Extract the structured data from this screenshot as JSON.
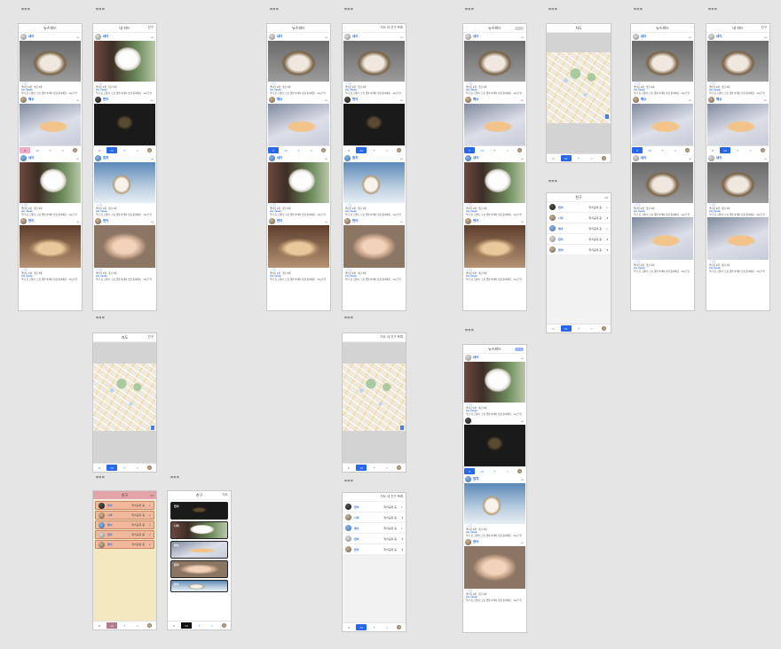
{
  "labels": {
    "a1": "===",
    "a2": "===",
    "a3": "===",
    "a4": "===",
    "a5": "===",
    "a6": "===",
    "a7": "===",
    "a8": "===",
    "b1": "===",
    "b2": "===",
    "b3": "===",
    "b4": "===",
    "c1": "===",
    "c2": "===",
    "c3": "===",
    "c4": "==="
  },
  "screen_titles": {
    "feed": "뉴스피드",
    "feed_mine": "내 피드",
    "map": "지도",
    "friends": "친구",
    "myfeed_right": "지도 내 친구 목록"
  },
  "feed": {
    "users": [
      "내이",
      "해수",
      "나비",
      "참치",
      "찐이"
    ],
    "meta": "좋아요 2개 · 댓글 3개",
    "who": "cat_meow",
    "text": "우리 집 고양이, 오늘 햇살 아래서 낮잠 중이에요 · 1시간 전"
  },
  "friends": {
    "names": [
      "찐이",
      "나비",
      "해수",
      "참치",
      "찐이"
    ],
    "status": "위치공유 중"
  },
  "tabs": {
    "home": "⌂",
    "feed": "▭",
    "add": "+",
    "search": "○"
  },
  "icons": [
    "home-icon",
    "feed-icon",
    "add-icon",
    "search-icon",
    "profile-avatar-icon",
    "more-dots-icon",
    "check-icon",
    "zoom-control-icon"
  ]
}
